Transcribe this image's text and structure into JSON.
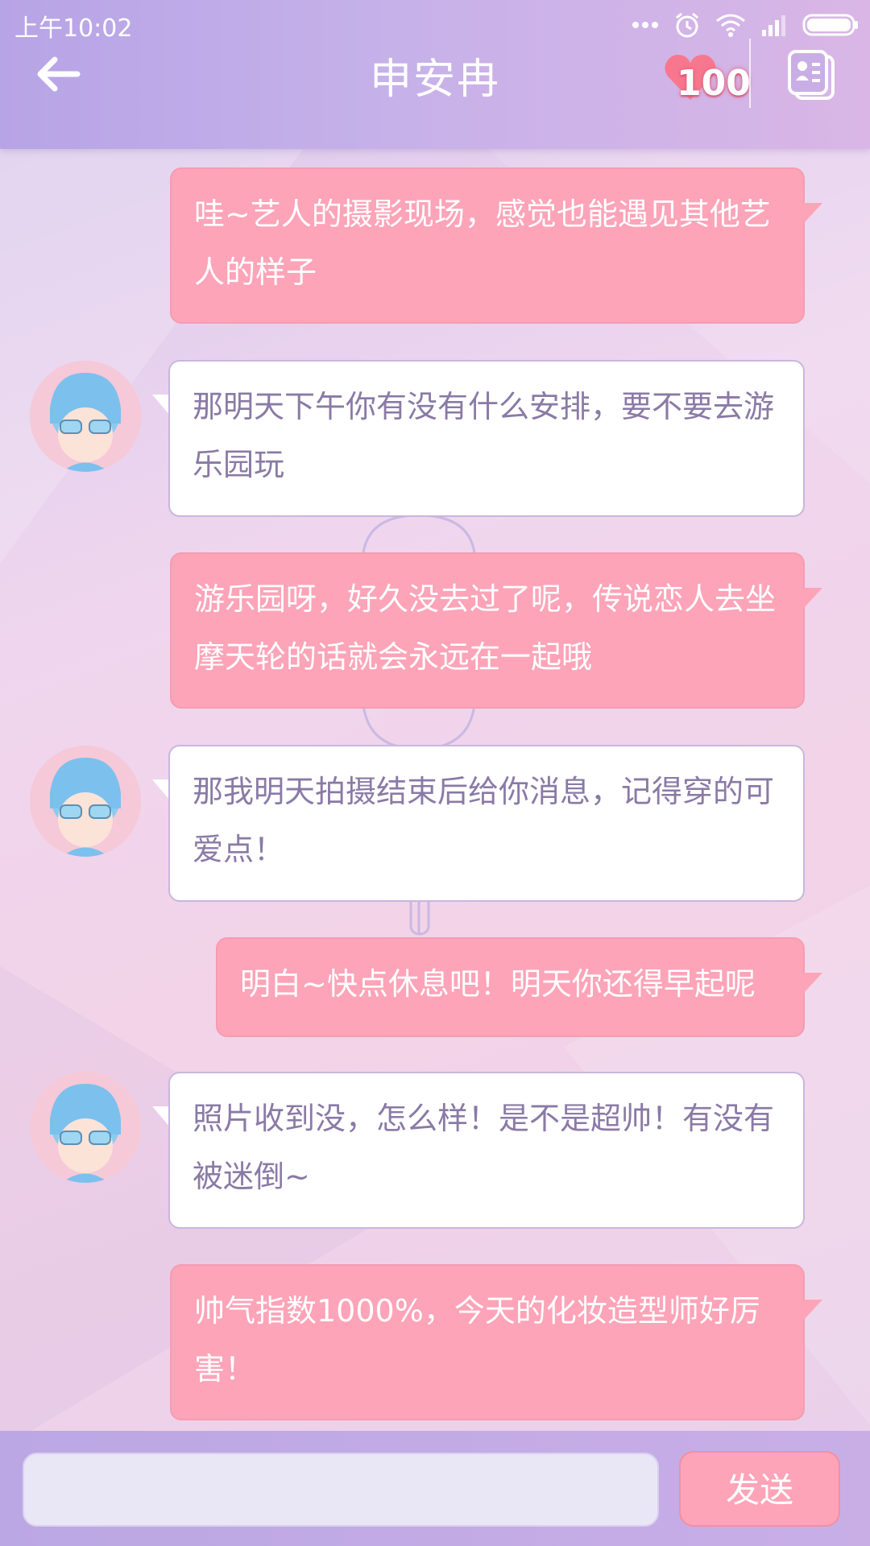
{
  "status": {
    "time": "上午10:02"
  },
  "header": {
    "title": "申安冉",
    "favor": "100"
  },
  "messages": [
    {
      "side": "out",
      "text": "哇~艺人的摄影现场，感觉也能遇见其他艺人的样子"
    },
    {
      "side": "in",
      "text": "那明天下午你有没有什么安排，要不要去游乐园玩"
    },
    {
      "side": "out",
      "text": "游乐园呀，好久没去过了呢，传说恋人去坐摩天轮的话就会永远在一起哦"
    },
    {
      "side": "in",
      "text": "那我明天拍摄结束后给你消息，记得穿的可爱点！"
    },
    {
      "side": "out",
      "text": "明白~快点休息吧！明天你还得早起呢"
    },
    {
      "side": "in",
      "text": "照片收到没，怎么样！是不是超帅！有没有被迷倒~"
    },
    {
      "side": "out",
      "text": "帅气指数1000%，今天的化妆造型师好厉害！"
    }
  ],
  "composer": {
    "input_value": "",
    "send_label": "发送"
  },
  "colors": {
    "out_bubble": "#fda4b8",
    "in_bubble": "#ffffff",
    "in_text": "#8a7aa6",
    "header": "#c6b1e9"
  }
}
